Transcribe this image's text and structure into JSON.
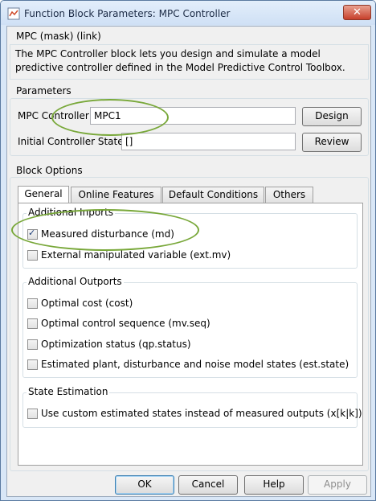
{
  "window": {
    "title": "Function Block Parameters: MPC Controller",
    "close_glyph": "✕"
  },
  "header": {
    "mask_title": "MPC (mask) (link)",
    "description": "The MPC Controller block lets you design and simulate a model predictive controller defined in the Model Predictive Control Toolbox."
  },
  "parameters": {
    "group_title": "Parameters",
    "mpc_controller_label": "MPC Controller",
    "mpc_controller_value": "MPC1",
    "design_label": "Design",
    "initial_state_label": "Initial Controller State",
    "initial_state_value": "[]",
    "review_label": "Review"
  },
  "block_options": {
    "group_title": "Block Options",
    "tabs": [
      {
        "label": "General",
        "active": true
      },
      {
        "label": "Online Features",
        "active": false
      },
      {
        "label": "Default Conditions",
        "active": false
      },
      {
        "label": "Others",
        "active": false
      }
    ],
    "additional_inports": {
      "title": "Additional Inports",
      "items": [
        {
          "label": "Measured disturbance (md)",
          "checked": true
        },
        {
          "label": "External manipulated variable (ext.mv)",
          "checked": false
        }
      ]
    },
    "additional_outports": {
      "title": "Additional Outports",
      "items": [
        {
          "label": "Optimal cost (cost)",
          "checked": false
        },
        {
          "label": "Optimal control sequence (mv.seq)",
          "checked": false
        },
        {
          "label": "Optimization status (qp.status)",
          "checked": false
        },
        {
          "label": "Estimated plant, disturbance and noise model states (est.state)",
          "checked": false
        }
      ]
    },
    "state_estimation": {
      "title": "State Estimation",
      "items": [
        {
          "label": "Use custom estimated states instead of measured outputs (x[k|k])",
          "checked": false
        }
      ]
    }
  },
  "footer": {
    "ok_label": "OK",
    "cancel_label": "Cancel",
    "help_label": "Help",
    "apply_label": "Apply"
  },
  "checkmark_glyph": "✓",
  "colors": {
    "highlight_ellipse": "#79a83a",
    "title_bar": "#cfe0f5",
    "close_button": "#c7402b"
  }
}
